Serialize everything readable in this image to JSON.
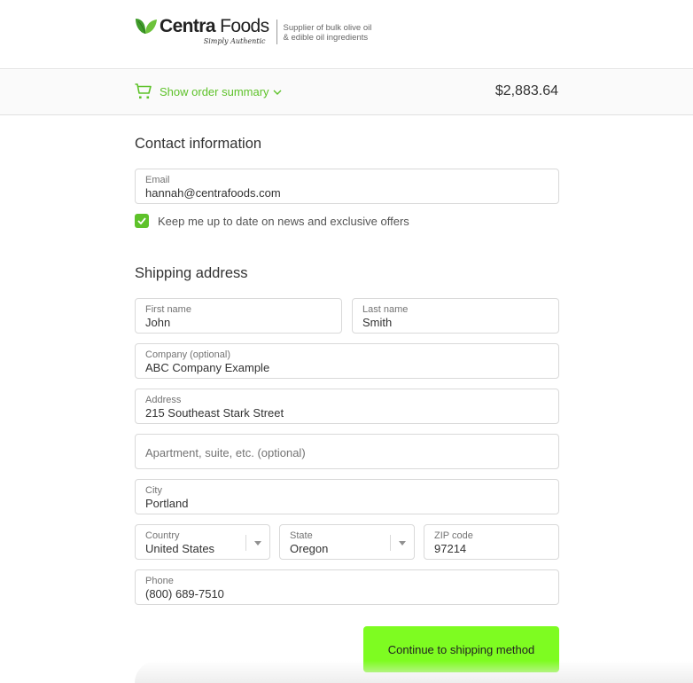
{
  "header": {
    "brand_first": "Centra",
    "brand_second": " Foods",
    "tagline": "Simply Authentic",
    "subtitle_line1": "Supplier of bulk olive oil",
    "subtitle_line2": "& edible oil ingredients"
  },
  "summary": {
    "toggle_label": "Show order summary",
    "total": "$2,883.64",
    "icon": "cart-icon",
    "accent_color": "#5ec22a"
  },
  "contact": {
    "title": "Contact information",
    "email": {
      "label": "Email",
      "value": "hannah@centrafoods.com"
    },
    "newsletter": {
      "label": "Keep me up to date on news and exclusive offers",
      "checked": true
    }
  },
  "shipping": {
    "title": "Shipping address",
    "first_name": {
      "label": "First name",
      "value": "John"
    },
    "last_name": {
      "label": "Last name",
      "value": "Smith"
    },
    "company": {
      "label": "Company (optional)",
      "value": "ABC Company Example"
    },
    "address": {
      "label": "Address",
      "value": "215 Southeast Stark Street"
    },
    "apartment": {
      "placeholder": "Apartment, suite, etc. (optional)",
      "value": ""
    },
    "city": {
      "label": "City",
      "value": "Portland"
    },
    "country": {
      "label": "Country",
      "value": "United States"
    },
    "state": {
      "label": "State",
      "value": "Oregon"
    },
    "zip": {
      "label": "ZIP code",
      "value": "97214"
    },
    "phone": {
      "label": "Phone",
      "value": "(800) 689-7510"
    }
  },
  "actions": {
    "continue_label": "Continue to shipping method",
    "button_color": "#7efc21"
  }
}
